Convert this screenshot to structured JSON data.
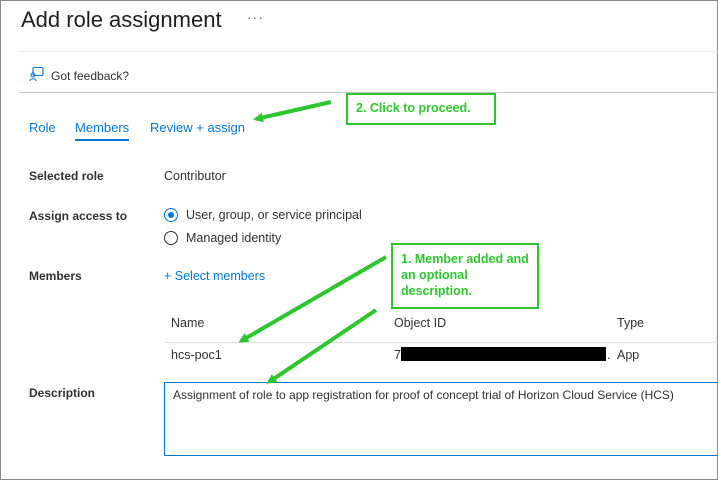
{
  "page": {
    "title": "Add role assignment",
    "more_label": "···",
    "feedback_label": "Got feedback?"
  },
  "tabs": [
    {
      "label": "Role"
    },
    {
      "label": "Members"
    },
    {
      "label": "Review + assign"
    }
  ],
  "form": {
    "selected_role_label": "Selected role",
    "selected_role_value": "Contributor",
    "assign_access_label": "Assign access to",
    "radio_options": [
      "User, group, or service principal",
      "Managed identity"
    ],
    "members_label": "Members",
    "select_members_label": "+ Select members",
    "table": {
      "headers": [
        "Name",
        "Object ID",
        "Type"
      ],
      "rows": [
        {
          "name": "hcs-poc1",
          "object_id_prefix": "7",
          "object_id_suffix": ".",
          "type": "App"
        }
      ]
    },
    "description_label": "Description",
    "description_value": "Assignment of role to app registration for proof of concept trial of Horizon Cloud Service  (HCS)"
  },
  "callouts": {
    "proceed": "2. Click to proceed.",
    "member_added": "1. Member added and an optional description."
  },
  "colors": {
    "accent": "#0078d4",
    "callout": "#2ec62e"
  }
}
